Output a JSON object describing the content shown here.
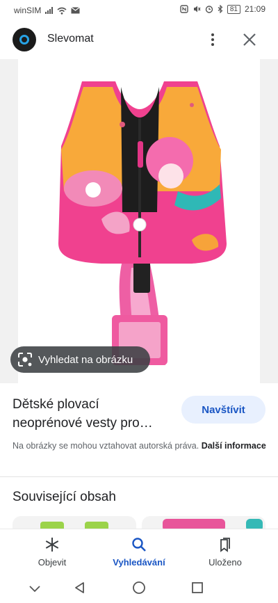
{
  "status_bar": {
    "carrier": "winSIM",
    "battery": "81",
    "time": "21:09"
  },
  "app_header": {
    "title": "Slevomat",
    "menu_icon": "more-vert-icon",
    "close_icon": "close-icon"
  },
  "image_viewer": {
    "lens_button_label": "Vyhledat na obrázku"
  },
  "result": {
    "title_line1": "Dětské plovací",
    "title_line2": "neoprénové vesty pro…",
    "visit_label": "Navštívit",
    "copyright_text": "Na obrázky se mohou vztahovat autorská práva.",
    "more_info_label": "Další informace"
  },
  "related": {
    "heading": "Související obsah"
  },
  "bottom_nav": {
    "items": [
      {
        "label": "Objevit",
        "icon": "asterisk-icon",
        "active": false
      },
      {
        "label": "Vyhledávání",
        "icon": "search-icon",
        "active": true
      },
      {
        "label": "Uloženo",
        "icon": "bookmarks-icon",
        "active": false
      }
    ]
  },
  "colors": {
    "accent": "#1a56c4",
    "visit_bg": "#e8f0fe",
    "vest_pink": "#f0418f",
    "vest_orange": "#f8a93a"
  }
}
